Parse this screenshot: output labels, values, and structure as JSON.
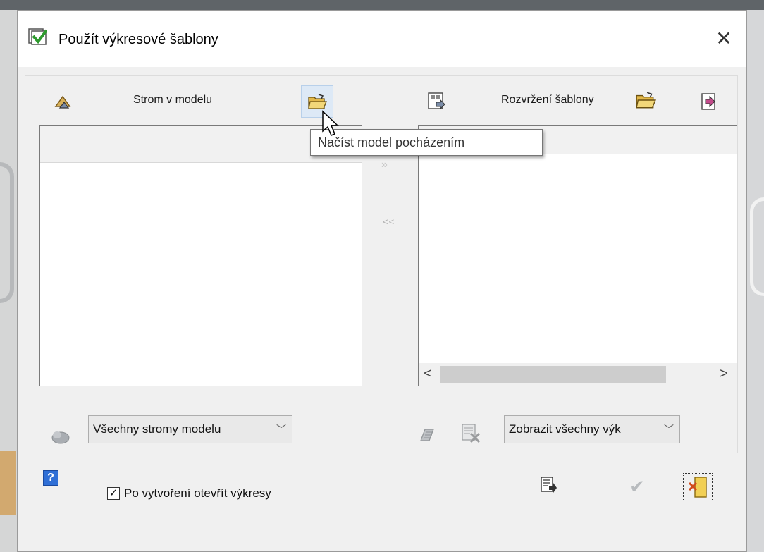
{
  "dialog": {
    "title": "Použít výkresové šablony",
    "close_glyph": "✕"
  },
  "left_panel": {
    "heading": "Strom v modelu",
    "icons": [
      "parent-tree-icon",
      "open-folder-icon"
    ],
    "filter_combo": {
      "selected": "Všechny stromy modelu"
    }
  },
  "middle": {
    "add_arrow": "»",
    "remove_arrow": "<<"
  },
  "right_panel": {
    "heading": "Rozvržení šablony",
    "icons": [
      "template-layout-icon",
      "open-folder-icon",
      "export-icon"
    ],
    "scroll_left": "<",
    "scroll_right": ">",
    "filter_combo": {
      "selected": "Zobrazit všechny výk"
    }
  },
  "tooltip": {
    "text": "Načíst model pocházením"
  },
  "footer": {
    "open_after_create_label": "Po vytvoření otevřít výkresy",
    "open_after_create_checked": true,
    "check_glyph": "✓",
    "help_glyph": "?",
    "confirm_glyph": "✔"
  },
  "colors": {
    "dialog_bg": "#f0f0f0",
    "help_blue": "#2f6fd6",
    "folder_yellow": "#e6c14a"
  }
}
